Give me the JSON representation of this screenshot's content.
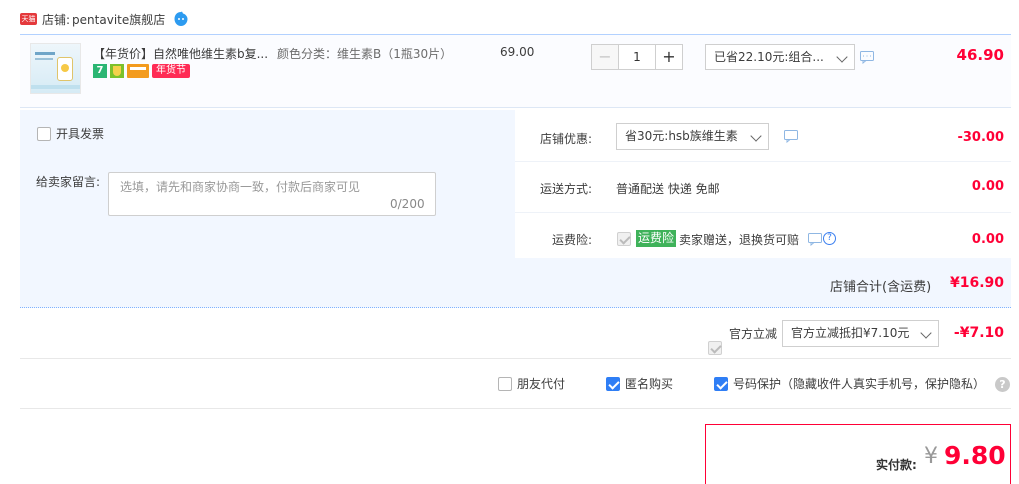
{
  "shop": {
    "badge": "天猫",
    "label": "店铺:",
    "name": "pentavite旗舰店"
  },
  "item": {
    "title": "【年货价】自然唯他维生素b复...",
    "badges": {
      "seven": "7",
      "nhj": "年货节"
    },
    "sku": "颜色分类：维生素B（1瓶30片）",
    "unit_price": "69.00",
    "quantity": "1",
    "qty_minus": "−",
    "qty_plus": "+",
    "promo": "已省22.10元:组合...",
    "total": "46.90"
  },
  "invoice": {
    "label": "开具发票"
  },
  "message": {
    "label": "给卖家留言:",
    "placeholder": "选填，请先和商家协商一致，付款后商家可见",
    "count": "0/200"
  },
  "store_discount": {
    "label": "店铺优惠:",
    "selected": "省30元:hsb族维生素",
    "amount": "-30.00"
  },
  "shipping": {
    "label": "运送方式:",
    "value": "普通配送 快递 免邮",
    "amount": "0.00"
  },
  "insurance": {
    "label": "运费险:",
    "tag": "运费险",
    "text": "卖家赠送，退换货可赔",
    "amount": "0.00",
    "help": "?"
  },
  "subtotal": {
    "label": "店铺合计(含运费)",
    "amount": "¥16.90"
  },
  "official": {
    "label": "官方立减",
    "selected": "官方立减抵扣¥7.10元",
    "amount": "-¥7.10"
  },
  "options": {
    "friend_pay": "朋友代付",
    "anonymous": "匿名购买",
    "phone_protect": "号码保护（隐藏收件人真实手机号，保护隐私）",
    "help": "?"
  },
  "payment": {
    "label": "实付款:",
    "currency": "¥",
    "amount": "9.80"
  },
  "colors": {
    "price_red": "#ff0036",
    "accent_blue": "#2f7ef5",
    "panel_bg": "#f2f7ff"
  }
}
